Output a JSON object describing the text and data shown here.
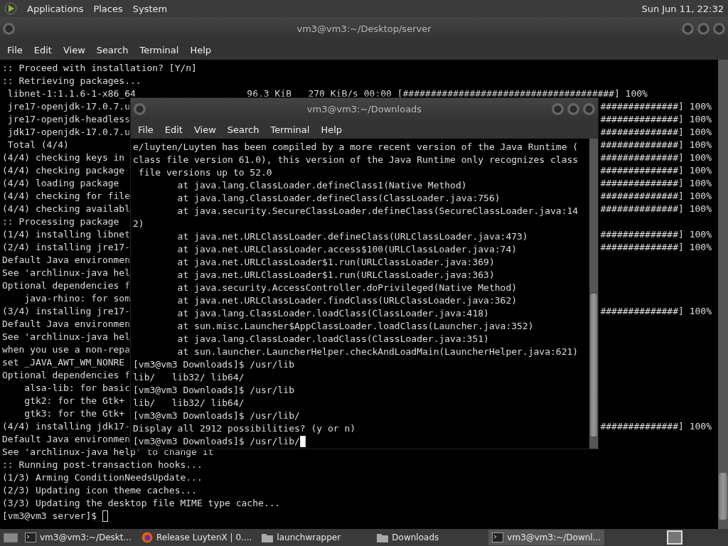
{
  "top_panel": {
    "menus": [
      "Applications",
      "Places",
      "System"
    ],
    "clock": "Sun Jun 11, 22:32"
  },
  "back_window": {
    "title": "vm3@vm3:~/Desktop/server",
    "menu": [
      "File",
      "Edit",
      "View",
      "Search",
      "Terminal",
      "Help"
    ],
    "lines": [
      {
        "text": ":: Proceed with installation? [Y/n]"
      },
      {
        "text": ":: Retrieving packages..."
      },
      {
        "text": " libnet-1:1.1.6-1-x86_64                    96.3 KiB   270 KiB/s 00:00 [######################################] 100%"
      },
      {
        "text": " jre17-openjdk-17.0.7.u",
        "tail": "##############] 100%"
      },
      {
        "text": " jre17-openjdk-headless",
        "tail": "##############] 100%"
      },
      {
        "text": " jdk17-openjdk-17.0.7.u",
        "tail": "##############] 100%"
      },
      {
        "text": " Total (4/4)",
        "tail": "##############] 100%"
      },
      {
        "text": "(4/4) checking keys in",
        "tail": "##############] 100%"
      },
      {
        "text": "(4/4) checking package",
        "tail": "##############] 100%"
      },
      {
        "text": "(4/4) loading package",
        "tail": "##############] 100%"
      },
      {
        "text": "(4/4) checking for file",
        "tail": "##############] 100%"
      },
      {
        "text": "(4/4) checking availabl",
        "tail": "##############] 100%"
      },
      {
        "text": ":: Processing package"
      },
      {
        "text": "(1/4) installing libnet",
        "tail": "##############] 100%"
      },
      {
        "text": "(2/4) installing jre17-",
        "tail": "##############] 100%"
      },
      {
        "text": "Default Java environmen"
      },
      {
        "text": "See 'archlinux-java hel"
      },
      {
        "text": "Optional dependencies f"
      },
      {
        "text": "    java-rhino: for som"
      },
      {
        "text": "(3/4) installing jre17-",
        "tail": "##############] 100%"
      },
      {
        "text": "Default Java environmen"
      },
      {
        "text": "See 'archlinux-java hel"
      },
      {
        "text": "when you use a non-repa"
      },
      {
        "text": "set _JAVA_AWT_WM_NONRE"
      },
      {
        "text": "Optional dependencies f"
      },
      {
        "text": "    alsa-lib: for basic"
      },
      {
        "text": "    gtk2: for the Gtk+"
      },
      {
        "text": "    gtk3: for the Gtk+"
      },
      {
        "text": "(4/4) installing jdk17-",
        "tail": "##############] 100%"
      },
      {
        "text": "Default Java environmen"
      },
      {
        "text": "See 'archlinux-java help' to change it"
      },
      {
        "text": ":: Running post-transaction hooks..."
      },
      {
        "text": "(1/3) Arming ConditionNeedsUpdate..."
      },
      {
        "text": "(2/3) Updating icon theme caches..."
      },
      {
        "text": "(3/3) Updating the desktop file MIME type cache..."
      },
      {
        "text": "[vm3@vm3 server]$ ",
        "cursor_filled": false
      }
    ]
  },
  "front_window": {
    "title": "vm3@vm3:~/Downloads",
    "menu": [
      "File",
      "Edit",
      "View",
      "Search",
      "Terminal",
      "Help"
    ],
    "lines": [
      {
        "text": "e/luyten/Luyten has been compiled by a more recent version of the Java Runtime ("
      },
      {
        "text": "class file version 61.0), this version of the Java Runtime only recognizes class"
      },
      {
        "text": " file versions up to 52.0"
      },
      {
        "text": "        at java.lang.ClassLoader.defineClass1(Native Method)"
      },
      {
        "text": "        at java.lang.ClassLoader.defineClass(ClassLoader.java:756)"
      },
      {
        "text": "        at java.security.SecureClassLoader.defineClass(SecureClassLoader.java:14"
      },
      {
        "text": "2)"
      },
      {
        "text": "        at java.net.URLClassLoader.defineClass(URLClassLoader.java:473)"
      },
      {
        "text": "        at java.net.URLClassLoader.access$100(URLClassLoader.java:74)"
      },
      {
        "text": "        at java.net.URLClassLoader$1.run(URLClassLoader.java:369)"
      },
      {
        "text": "        at java.net.URLClassLoader$1.run(URLClassLoader.java:363)"
      },
      {
        "text": "        at java.security.AccessController.doPrivileged(Native Method)"
      },
      {
        "text": "        at java.net.URLClassLoader.findClass(URLClassLoader.java:362)"
      },
      {
        "text": "        at java.lang.ClassLoader.loadClass(ClassLoader.java:418)"
      },
      {
        "text": "        at sun.misc.Launcher$AppClassLoader.loadClass(Launcher.java:352)"
      },
      {
        "text": "        at java.lang.ClassLoader.loadClass(ClassLoader.java:351)"
      },
      {
        "text": "        at sun.launcher.LauncherHelper.checkAndLoadMain(LauncherHelper.java:621)"
      },
      {
        "text": "[vm3@vm3 Downloads]$ /usr/lib"
      },
      {
        "text": "lib/   lib32/ lib64/"
      },
      {
        "text": "[vm3@vm3 Downloads]$ /usr/lib"
      },
      {
        "text": "lib/   lib32/ lib64/"
      },
      {
        "text": "[vm3@vm3 Downloads]$ /usr/lib/"
      },
      {
        "text": "Display all 2912 possibilities? (y or n)"
      },
      {
        "text": "[vm3@vm3 Downloads]$ /usr/lib/",
        "cursor_filled": true
      }
    ]
  },
  "taskbar": {
    "items": [
      {
        "kind": "terminal",
        "label": "vm3@vm3:~/Deskt...",
        "selected": false
      },
      {
        "kind": "browser",
        "label": "Release LuytenX | 0....",
        "selected": false
      },
      {
        "kind": "folder",
        "label": "launchwrapper",
        "selected": false
      },
      {
        "kind": "folder",
        "label": "Downloads",
        "selected": false
      },
      {
        "kind": "terminal",
        "label": "vm3@vm3:~/Downl...",
        "selected": true
      }
    ]
  }
}
